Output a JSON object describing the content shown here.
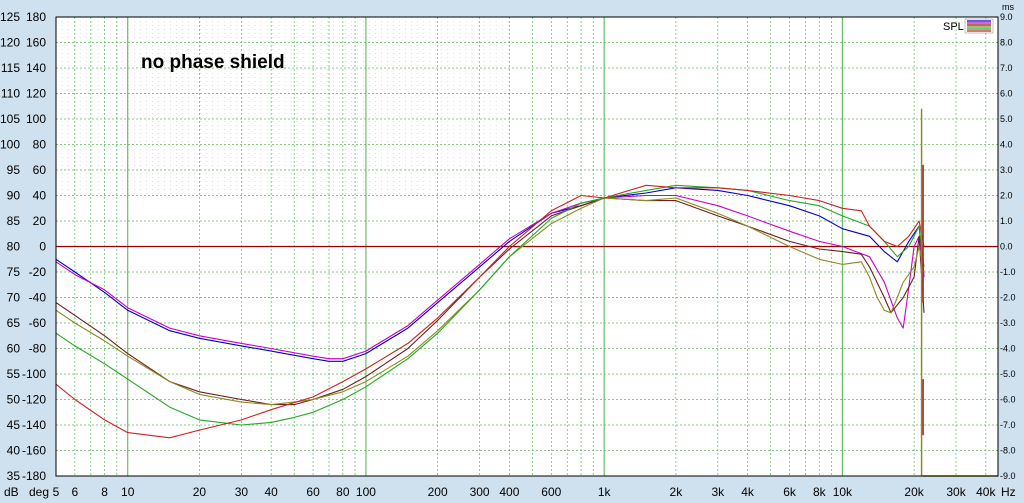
{
  "colors": {
    "background": "#cfe0ee",
    "plot": "#ffffff",
    "grid": "#5cb85c",
    "zero_line": "#a00000"
  },
  "chart_data": {
    "type": "line",
    "annotation": "no phase shield",
    "legend": {
      "label": "SPL",
      "placement": "top-right"
    },
    "x_scale": "log",
    "xlim": [
      5,
      45000
    ],
    "x_unit": "Hz",
    "x_ticks": [
      {
        "v": 5,
        "t": "5"
      },
      {
        "v": 6,
        "t": "6"
      },
      {
        "v": 8,
        "t": "8"
      },
      {
        "v": 10,
        "t": "10"
      },
      {
        "v": 20,
        "t": "20"
      },
      {
        "v": 30,
        "t": "30"
      },
      {
        "v": 40,
        "t": "40"
      },
      {
        "v": 60,
        "t": "60"
      },
      {
        "v": 80,
        "t": "80"
      },
      {
        "v": 100,
        "t": "100"
      },
      {
        "v": 200,
        "t": "200"
      },
      {
        "v": 300,
        "t": "300"
      },
      {
        "v": 400,
        "t": "400"
      },
      {
        "v": 600,
        "t": "600"
      },
      {
        "v": 1000,
        "t": "1k"
      },
      {
        "v": 2000,
        "t": "2k"
      },
      {
        "v": 3000,
        "t": "3k"
      },
      {
        "v": 4000,
        "t": "4k"
      },
      {
        "v": 6000,
        "t": "6k"
      },
      {
        "v": 8000,
        "t": "8k"
      },
      {
        "v": 10000,
        "t": "10k"
      },
      {
        "v": 20000,
        "t": "20k"
      },
      {
        "v": 30000,
        "t": "30k"
      },
      {
        "v": 40000,
        "t": "40k"
      }
    ],
    "dB_axis": {
      "unit": "dB",
      "lim": [
        35,
        125
      ],
      "ticks": [
        "125",
        "120",
        "115",
        "110",
        "105",
        "100",
        "95",
        "90",
        "85",
        "80",
        "75",
        "70",
        "65",
        "60",
        "55",
        "50",
        "45",
        "40",
        "35"
      ]
    },
    "deg_axis": {
      "unit": "deg",
      "lim": [
        -180,
        180
      ],
      "ticks": [
        "180",
        "160",
        "140",
        "120",
        "100",
        "80",
        "60",
        "40",
        "20",
        "0",
        "-20",
        "-40",
        "-60",
        "-80",
        "-100",
        "-120",
        "-140",
        "-160",
        "-180"
      ]
    },
    "ms_axis": {
      "unit": "ms",
      "lim": [
        -9.0,
        9.0
      ],
      "ticks": [
        "9.0",
        "8.0",
        "7.0",
        "6.0",
        "5.0",
        "4.0",
        "3.0",
        "2.0",
        "1.0",
        "0.0",
        "-1.0",
        "-2.0",
        "-3.0",
        "-4.0",
        "-5.0",
        "-6.0",
        "-7.0",
        "-8.0",
        "-9.0"
      ]
    },
    "series": [
      {
        "color": "#0000cc",
        "points": [
          [
            5,
            77.5
          ],
          [
            6,
            75
          ],
          [
            8,
            71
          ],
          [
            10,
            67.5
          ],
          [
            15,
            63.5
          ],
          [
            20,
            62
          ],
          [
            30,
            60.5
          ],
          [
            40,
            59.5
          ],
          [
            60,
            58
          ],
          [
            70,
            57.5
          ],
          [
            80,
            57.5
          ],
          [
            100,
            59
          ],
          [
            150,
            64
          ],
          [
            200,
            69
          ],
          [
            300,
            76
          ],
          [
            400,
            81
          ],
          [
            600,
            86.5
          ],
          [
            800,
            88
          ],
          [
            1000,
            89.5
          ],
          [
            1500,
            90.5
          ],
          [
            2000,
            91.5
          ],
          [
            3000,
            91
          ],
          [
            4000,
            90
          ],
          [
            6000,
            88
          ],
          [
            8000,
            86
          ],
          [
            10000,
            83.5
          ],
          [
            13000,
            82
          ],
          [
            15000,
            79
          ],
          [
            17000,
            77
          ],
          [
            19000,
            81
          ],
          [
            21000,
            84
          ],
          [
            22000,
            74
          ]
        ]
      },
      {
        "color": "#cc00cc",
        "points": [
          [
            5,
            77
          ],
          [
            6,
            74.5
          ],
          [
            8,
            71.5
          ],
          [
            10,
            68
          ],
          [
            15,
            64
          ],
          [
            20,
            62.5
          ],
          [
            30,
            61
          ],
          [
            40,
            60
          ],
          [
            60,
            58.5
          ],
          [
            70,
            58
          ],
          [
            80,
            58
          ],
          [
            100,
            59.5
          ],
          [
            150,
            64.5
          ],
          [
            200,
            69.5
          ],
          [
            300,
            76.5
          ],
          [
            400,
            81.5
          ],
          [
            600,
            86.5
          ],
          [
            800,
            88.5
          ],
          [
            1000,
            89.5
          ],
          [
            1500,
            90
          ],
          [
            2000,
            90
          ],
          [
            3000,
            88
          ],
          [
            4000,
            86
          ],
          [
            6000,
            83
          ],
          [
            8000,
            81
          ],
          [
            10000,
            80
          ],
          [
            13000,
            78
          ],
          [
            15000,
            73
          ],
          [
            17000,
            66
          ],
          [
            18000,
            64
          ],
          [
            19000,
            72
          ],
          [
            20000,
            80
          ],
          [
            21000,
            82
          ],
          [
            22000,
            74
          ]
        ]
      },
      {
        "color": "#6b1f1f",
        "points": [
          [
            5,
            69
          ],
          [
            6,
            66.5
          ],
          [
            8,
            62.5
          ],
          [
            10,
            59
          ],
          [
            15,
            53.5
          ],
          [
            20,
            51.5
          ],
          [
            30,
            50
          ],
          [
            40,
            49
          ],
          [
            50,
            49
          ],
          [
            60,
            50
          ],
          [
            80,
            52
          ],
          [
            100,
            54.5
          ],
          [
            150,
            60
          ],
          [
            200,
            65.5
          ],
          [
            300,
            74
          ],
          [
            400,
            79.5
          ],
          [
            600,
            86
          ],
          [
            800,
            88
          ],
          [
            1000,
            89.5
          ],
          [
            1500,
            89
          ],
          [
            2000,
            89
          ],
          [
            3000,
            86
          ],
          [
            4000,
            84
          ],
          [
            6000,
            81
          ],
          [
            8000,
            79.5
          ],
          [
            10000,
            79
          ],
          [
            12000,
            78.5
          ],
          [
            13000,
            76
          ],
          [
            15000,
            70
          ],
          [
            16000,
            67
          ],
          [
            18000,
            70
          ],
          [
            20000,
            74
          ],
          [
            21000,
            82
          ],
          [
            22000,
            67
          ]
        ]
      },
      {
        "color": "#8b8b22",
        "points": [
          [
            5,
            67.5
          ],
          [
            6,
            65
          ],
          [
            8,
            61.5
          ],
          [
            10,
            58.5
          ],
          [
            15,
            53.5
          ],
          [
            20,
            51
          ],
          [
            30,
            49.5
          ],
          [
            40,
            49
          ],
          [
            50,
            49.5
          ],
          [
            60,
            50
          ],
          [
            80,
            51.5
          ],
          [
            100,
            53.5
          ],
          [
            150,
            58.5
          ],
          [
            200,
            63.5
          ],
          [
            300,
            71.5
          ],
          [
            400,
            78
          ],
          [
            600,
            84.5
          ],
          [
            800,
            87.5
          ],
          [
            1000,
            89.5
          ],
          [
            1500,
            89
          ],
          [
            2000,
            89.5
          ],
          [
            3000,
            86.5
          ],
          [
            4000,
            84
          ],
          [
            6000,
            80
          ],
          [
            8000,
            77.5
          ],
          [
            10000,
            76.5
          ],
          [
            12000,
            77
          ],
          [
            13000,
            74
          ],
          [
            14000,
            70
          ],
          [
            15000,
            67.5
          ],
          [
            16000,
            67
          ],
          [
            17000,
            70
          ],
          [
            18000,
            73
          ],
          [
            20000,
            76
          ],
          [
            21000,
            80
          ],
          [
            22000,
            75
          ]
        ]
      },
      {
        "color": "#22aa22",
        "points": [
          [
            5,
            63
          ],
          [
            6,
            60.5
          ],
          [
            8,
            57
          ],
          [
            10,
            54
          ],
          [
            15,
            48.5
          ],
          [
            20,
            46
          ],
          [
            30,
            45
          ],
          [
            40,
            45.5
          ],
          [
            50,
            46.5
          ],
          [
            60,
            47.5
          ],
          [
            80,
            50
          ],
          [
            100,
            52.5
          ],
          [
            150,
            58
          ],
          [
            200,
            63
          ],
          [
            300,
            71.5
          ],
          [
            400,
            78
          ],
          [
            600,
            85.5
          ],
          [
            800,
            88.5
          ],
          [
            1000,
            89.5
          ],
          [
            1500,
            91
          ],
          [
            2000,
            92
          ],
          [
            3000,
            91.5
          ],
          [
            4000,
            91
          ],
          [
            6000,
            89
          ],
          [
            8000,
            88
          ],
          [
            10000,
            86
          ],
          [
            13000,
            84
          ],
          [
            15000,
            81
          ],
          [
            17000,
            78
          ],
          [
            19000,
            80
          ],
          [
            21000,
            84
          ],
          [
            22000,
            76
          ]
        ]
      },
      {
        "color": "#cc2222",
        "points": [
          [
            5,
            53
          ],
          [
            6,
            50
          ],
          [
            8,
            46
          ],
          [
            10,
            43.5
          ],
          [
            15,
            42.5
          ],
          [
            20,
            44
          ],
          [
            30,
            46
          ],
          [
            40,
            48
          ],
          [
            60,
            50.5
          ],
          [
            80,
            53.5
          ],
          [
            100,
            56
          ],
          [
            150,
            61
          ],
          [
            200,
            66
          ],
          [
            300,
            74
          ],
          [
            400,
            80
          ],
          [
            600,
            87
          ],
          [
            800,
            90
          ],
          [
            1000,
            89.5
          ],
          [
            1500,
            92
          ],
          [
            2000,
            91.5
          ],
          [
            3000,
            91.5
          ],
          [
            4000,
            91
          ],
          [
            6000,
            90
          ],
          [
            8000,
            89
          ],
          [
            10000,
            87.5
          ],
          [
            12000,
            87
          ],
          [
            13000,
            84
          ],
          [
            15000,
            81
          ],
          [
            17000,
            80
          ],
          [
            19000,
            82
          ],
          [
            21000,
            85
          ],
          [
            22000,
            80
          ]
        ]
      }
    ]
  }
}
